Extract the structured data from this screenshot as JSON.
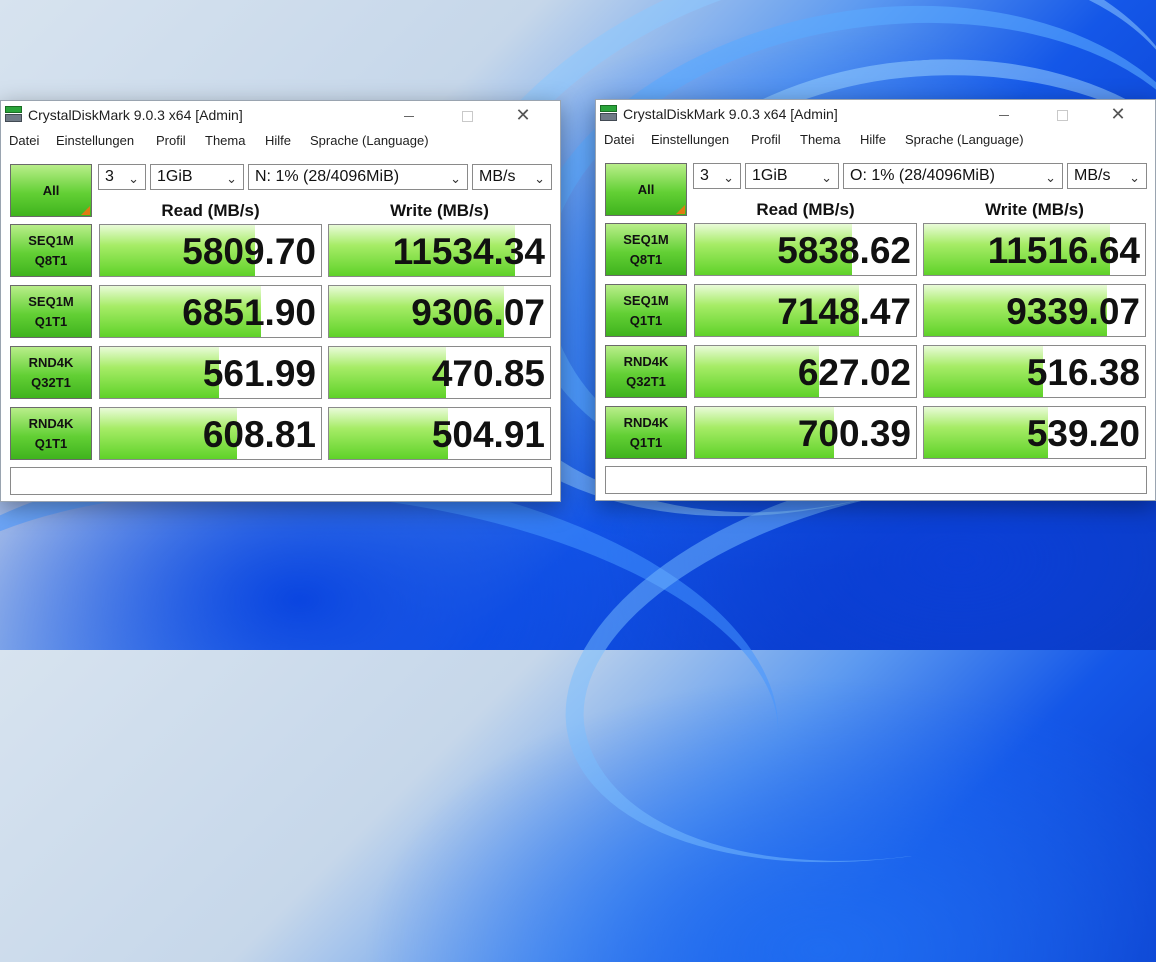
{
  "windows": [
    {
      "title": "CrystalDiskMark 9.0.3 x64 [Admin]",
      "menu": [
        "Datei",
        "Einstellungen",
        "Profil",
        "Thema",
        "Hilfe",
        "Sprache (Language)"
      ],
      "all_label": "All",
      "count": "3",
      "size": "1GiB",
      "drive": "N: 1% (28/4096MiB)",
      "unit": "MB/s",
      "read_header": "Read (MB/s)",
      "write_header": "Write (MB/s)",
      "tests": [
        {
          "line1": "SEQ1M",
          "line2": "Q8T1",
          "read": "5809.70",
          "write": "11534.34",
          "read_fill": 0.7,
          "write_fill": 0.84
        },
        {
          "line1": "SEQ1M",
          "line2": "Q1T1",
          "read": "6851.90",
          "write": "9306.07",
          "read_fill": 0.73,
          "write_fill": 0.79
        },
        {
          "line1": "RND4K",
          "line2": "Q32T1",
          "read": "561.99",
          "write": "470.85",
          "read_fill": 0.54,
          "write_fill": 0.53
        },
        {
          "line1": "RND4K",
          "line2": "Q1T1",
          "read": "608.81",
          "write": "504.91",
          "read_fill": 0.62,
          "write_fill": 0.54
        }
      ],
      "comment": ""
    },
    {
      "title": "CrystalDiskMark 9.0.3 x64 [Admin]",
      "menu": [
        "Datei",
        "Einstellungen",
        "Profil",
        "Thema",
        "Hilfe",
        "Sprache (Language)"
      ],
      "all_label": "All",
      "count": "3",
      "size": "1GiB",
      "drive": "O: 1% (28/4096MiB)",
      "unit": "MB/s",
      "read_header": "Read (MB/s)",
      "write_header": "Write (MB/s)",
      "tests": [
        {
          "line1": "SEQ1M",
          "line2": "Q8T1",
          "read": "5838.62",
          "write": "11516.64",
          "read_fill": 0.71,
          "write_fill": 0.84
        },
        {
          "line1": "SEQ1M",
          "line2": "Q1T1",
          "read": "7148.47",
          "write": "9339.07",
          "read_fill": 0.74,
          "write_fill": 0.83
        },
        {
          "line1": "RND4K",
          "line2": "Q32T1",
          "read": "627.02",
          "write": "516.38",
          "read_fill": 0.56,
          "write_fill": 0.54
        },
        {
          "line1": "RND4K",
          "line2": "Q1T1",
          "read": "700.39",
          "write": "539.20",
          "read_fill": 0.63,
          "write_fill": 0.56
        }
      ],
      "comment": ""
    }
  ],
  "colors": {
    "accent_green": "#63d035",
    "bar_green": "#a6ec66",
    "corner_orange": "#e07b12"
  }
}
